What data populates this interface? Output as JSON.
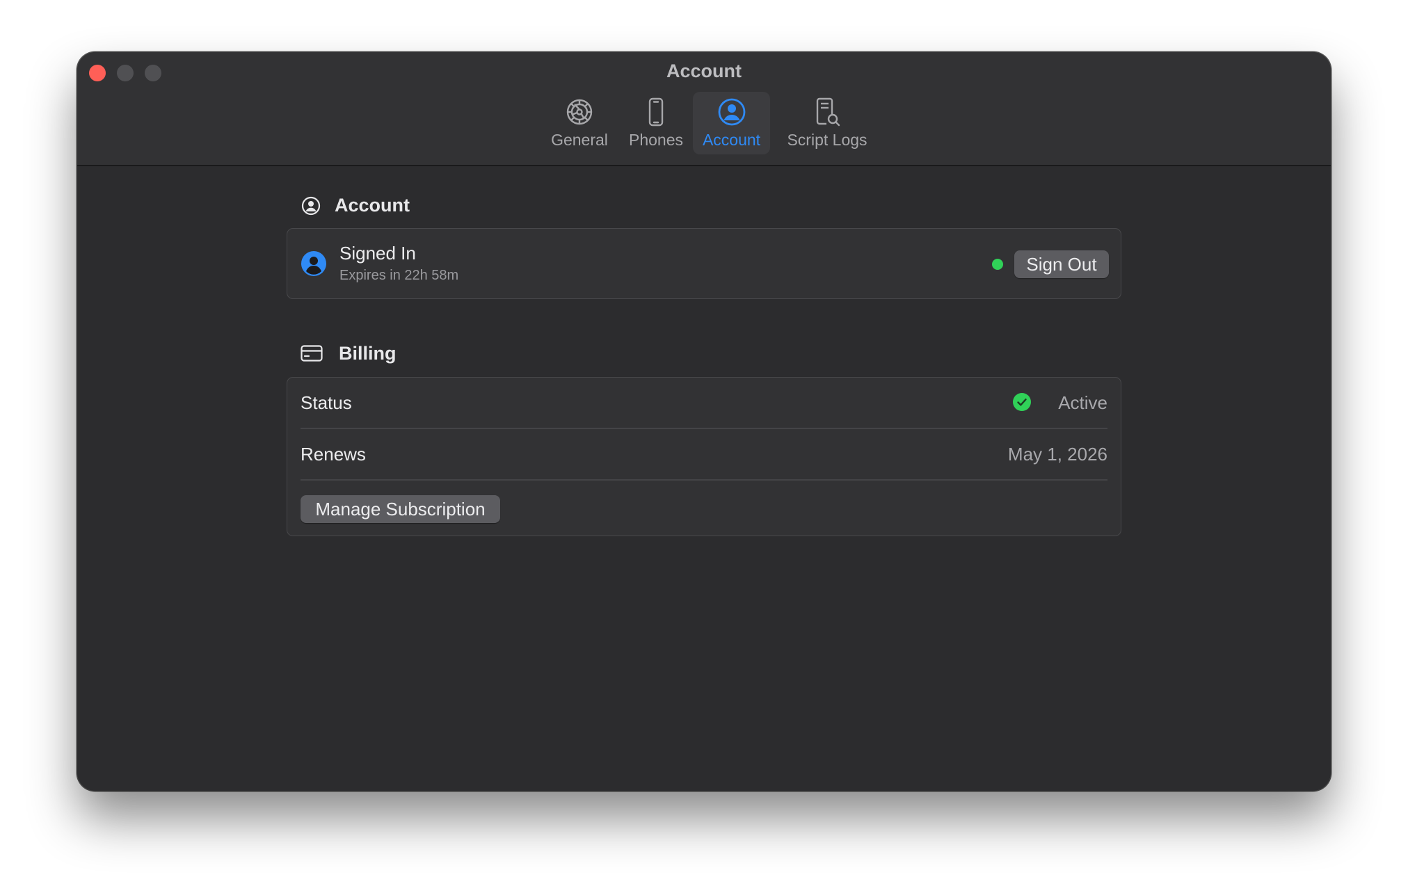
{
  "window": {
    "title": "Account"
  },
  "toolbar": {
    "tabs": [
      {
        "label": "General",
        "icon": "gear-icon",
        "active": false
      },
      {
        "label": "Phones",
        "icon": "phone-icon",
        "active": false
      },
      {
        "label": "Account",
        "icon": "person-circle-icon",
        "active": true
      },
      {
        "label": "Script Logs",
        "icon": "doc-magnifier-icon",
        "active": false
      }
    ]
  },
  "account_section": {
    "title": "Account",
    "icon": "person-circle-icon",
    "status_title": "Signed In",
    "status_subtitle": "Expires in 22h 58m",
    "status_indicator_color": "#30d158",
    "sign_out_label": "Sign Out"
  },
  "billing_section": {
    "title": "Billing",
    "icon": "credit-card-icon",
    "rows": [
      {
        "label": "Status",
        "value": "Active"
      },
      {
        "label": "Renews",
        "value": "May 1, 2026"
      }
    ],
    "manage_label": "Manage Subscription"
  },
  "colors": {
    "accent": "#2f8af5",
    "success": "#30d158",
    "close": "#ff5f57"
  }
}
